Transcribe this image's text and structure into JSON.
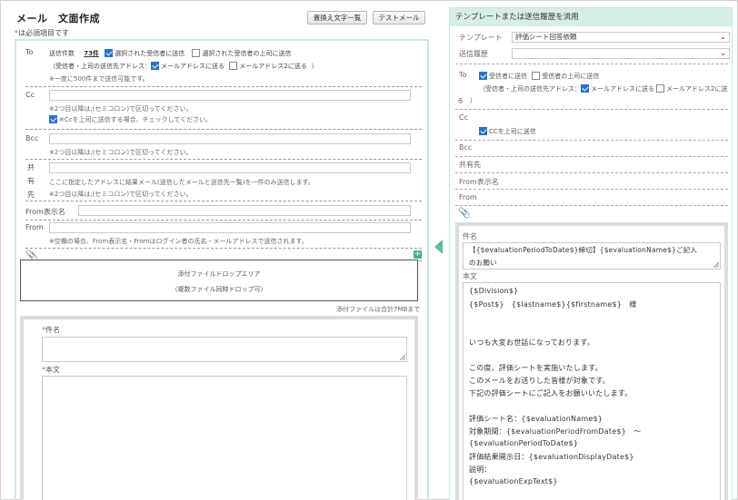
{
  "left": {
    "title": "メール　文面作成",
    "replace_text_button": "置換え文字一覧",
    "test_mail_button": "テストメール",
    "required_note": "は必須項目です",
    "required_mark": "*",
    "to": {
      "label": "To",
      "send_count_label": "送信件数",
      "send_count_value": "73件",
      "opt_selected_recipients": "選択された受信者に送信",
      "opt_selected_bosses": "選択された受信者の上司に送信",
      "address_label": "（受信者・上司の送信先アドレス：",
      "opt_mail1": "メールアドレスに送る",
      "opt_mail2": "メールアドレス2に送る",
      "address_close": "）",
      "note": "※一度に500件まで送信可能です。"
    },
    "cc": {
      "label": "Cc",
      "note1": "※2つ目以降は;(セミコロン)で区切ってください。",
      "check_label": "※Ccを上司に送信する場合、チェックしてください。"
    },
    "bcc": {
      "label": "Bcc",
      "note": "※2つ目以降は;(セミコロン)で区切ってください。"
    },
    "shared": {
      "label_chars": [
        "共",
        "有",
        "先"
      ],
      "note1": "ここに指定したアドレスに結果メール(送信したメールと送信先一覧)を一件のみ送信します。",
      "note2": "※2つ目以降は;(セミコロン)で区切ってください。"
    },
    "from_display": {
      "label": "From表示名"
    },
    "from": {
      "label": "From",
      "note": "※空欄の場合、From表示名・Fromはログイン者の氏名・メールアドレスで送信されます。"
    },
    "attach": {
      "plus": "+",
      "drop_line1": "添付ファイルドロップエリア",
      "drop_line2": "（複数ファイル同時ドロップ可）",
      "limit_note": "添付ファイルは合計7MBまで"
    },
    "subject_label": "件名",
    "body_label": "本文"
  },
  "right": {
    "header": "テンプレートまたは送信履歴を流用",
    "template_label": "テンプレート",
    "template_value": "評価シート回答依頼",
    "history_label": "送信履歴",
    "history_value": "",
    "to_label": "To",
    "opt_recipients": "受信者に送信",
    "opt_bosses": "受信者の上司に送信",
    "address_label": "（受信者・上司の送信先アドレス：",
    "opt_mail1": "メールアドレスに送る",
    "opt_mail2": "メールアドレス2に送",
    "address_wrap": "る　）",
    "cc_label": "Cc",
    "cc_check": "CCを上司に送信",
    "bcc_label": "Bcc",
    "shared_label": "共有先",
    "from_display_label": "From表示名",
    "from_label": "From",
    "subject_label": "件名",
    "subject_line1": "【{$evaluationPeriodToDate$}締切】{$evaluationName$}ご記入",
    "subject_line2": "のお願い",
    "body_label": "本文",
    "body_lines": [
      "{$Division$}",
      "{$Post$}　{$lastname$}{$firstname$}　様",
      "",
      "",
      "いつも大変お世話になっております。",
      "",
      "この度、評価シートを実施いたします。",
      "このメールをお送りした皆様が対象です。",
      "下記の評価シートにご記入をお願いいたします。",
      "",
      "評価シート名：{$evaluationName$}",
      "対象期間：{$evaluationPeriodFromDate$}　～",
      "{$evaluationPeriodToDate$}",
      "評価結果開示日：{$evaluationDisplayDate$}",
      "説明：",
      "{$evaluationExpText$}"
    ]
  }
}
